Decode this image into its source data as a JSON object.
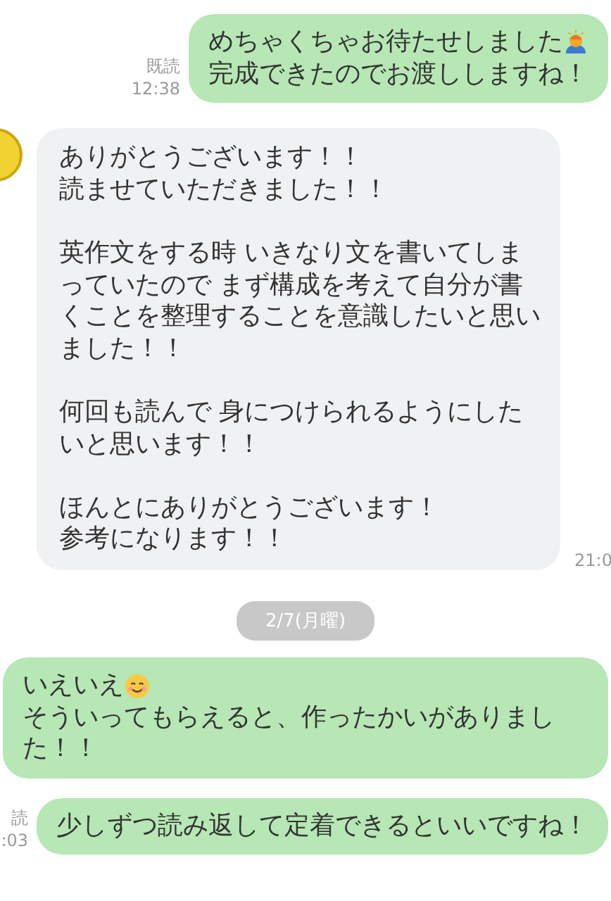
{
  "messages": [
    {
      "kind": "sent",
      "read_label": "既読",
      "time": "12:38",
      "paragraphs": [
        [
          {
            "text": "めちゃくちゃお待たせしました",
            "kind": "person-emoji"
          },
          {
            "text": "完成できたのでお渡ししますね！"
          }
        ]
      ]
    },
    {
      "kind": "received",
      "time": "21:0",
      "paragraphs": [
        [
          {
            "text": "ありがとうございます！！"
          },
          {
            "text": "読ませていただきました！！"
          }
        ],
        [
          {
            "text": "英作文をする時 いきなり文を書いてしま"
          },
          {
            "text": "っていたので まず構成を考えて自分が書"
          },
          {
            "text": "くことを整理することを意識したいと思い"
          },
          {
            "text": "ました！！"
          }
        ],
        [
          {
            "text": "何回も読んで 身につけられるようにした"
          },
          {
            "text": "いと思います！！"
          }
        ],
        [
          {
            "text": "ほんとにありがとうございます！"
          },
          {
            "text": "参考になります！！"
          }
        ]
      ]
    },
    {
      "kind": "date",
      "text": "2/7(月曜)"
    },
    {
      "kind": "sent",
      "paragraphs": [
        [
          {
            "text": "いえいえ",
            "kind": "smiley-emoji"
          },
          {
            "text": "そういってもらえると、作ったかいがありまし"
          },
          {
            "text": "た！！"
          }
        ]
      ]
    },
    {
      "kind": "sent",
      "read_label": "読",
      "time": ":03",
      "paragraphs": [
        [
          {
            "text": "少しずつ読み返して定着できるといいですね！"
          }
        ]
      ]
    }
  ]
}
